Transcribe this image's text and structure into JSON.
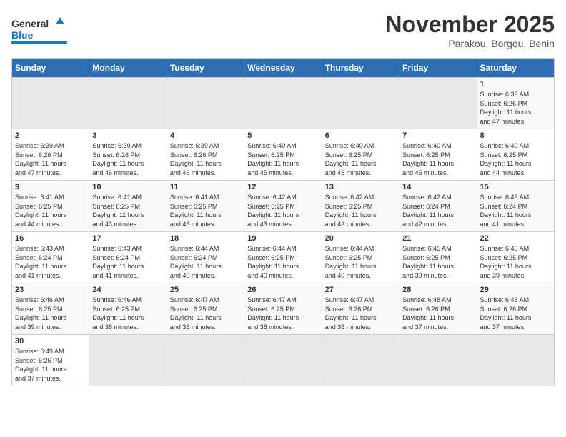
{
  "header": {
    "logo_general": "General",
    "logo_blue": "Blue",
    "title": "November 2025",
    "subtitle": "Parakou, Borgou, Benin"
  },
  "days_of_week": [
    "Sunday",
    "Monday",
    "Tuesday",
    "Wednesday",
    "Thursday",
    "Friday",
    "Saturday"
  ],
  "weeks": [
    [
      {
        "day": "",
        "info": ""
      },
      {
        "day": "",
        "info": ""
      },
      {
        "day": "",
        "info": ""
      },
      {
        "day": "",
        "info": ""
      },
      {
        "day": "",
        "info": ""
      },
      {
        "day": "",
        "info": ""
      },
      {
        "day": "1",
        "info": "Sunrise: 6:39 AM\nSunset: 6:26 PM\nDaylight: 11 hours\nand 47 minutes."
      }
    ],
    [
      {
        "day": "2",
        "info": "Sunrise: 6:39 AM\nSunset: 6:26 PM\nDaylight: 11 hours\nand 47 minutes."
      },
      {
        "day": "3",
        "info": "Sunrise: 6:39 AM\nSunset: 6:26 PM\nDaylight: 11 hours\nand 46 minutes."
      },
      {
        "day": "4",
        "info": "Sunrise: 6:39 AM\nSunset: 6:26 PM\nDaylight: 11 hours\nand 46 minutes."
      },
      {
        "day": "5",
        "info": "Sunrise: 6:40 AM\nSunset: 6:25 PM\nDaylight: 11 hours\nand 45 minutes."
      },
      {
        "day": "6",
        "info": "Sunrise: 6:40 AM\nSunset: 6:25 PM\nDaylight: 11 hours\nand 45 minutes."
      },
      {
        "day": "7",
        "info": "Sunrise: 6:40 AM\nSunset: 6:25 PM\nDaylight: 11 hours\nand 45 minutes."
      },
      {
        "day": "8",
        "info": "Sunrise: 6:40 AM\nSunset: 6:25 PM\nDaylight: 11 hours\nand 44 minutes."
      }
    ],
    [
      {
        "day": "9",
        "info": "Sunrise: 6:41 AM\nSunset: 6:25 PM\nDaylight: 11 hours\nand 44 minutes."
      },
      {
        "day": "10",
        "info": "Sunrise: 6:41 AM\nSunset: 6:25 PM\nDaylight: 11 hours\nand 43 minutes."
      },
      {
        "day": "11",
        "info": "Sunrise: 6:41 AM\nSunset: 6:25 PM\nDaylight: 11 hours\nand 43 minutes."
      },
      {
        "day": "12",
        "info": "Sunrise: 6:42 AM\nSunset: 6:25 PM\nDaylight: 11 hours\nand 43 minutes."
      },
      {
        "day": "13",
        "info": "Sunrise: 6:42 AM\nSunset: 6:25 PM\nDaylight: 11 hours\nand 42 minutes."
      },
      {
        "day": "14",
        "info": "Sunrise: 6:42 AM\nSunset: 6:24 PM\nDaylight: 11 hours\nand 42 minutes."
      },
      {
        "day": "15",
        "info": "Sunrise: 6:43 AM\nSunset: 6:24 PM\nDaylight: 11 hours\nand 41 minutes."
      }
    ],
    [
      {
        "day": "16",
        "info": "Sunrise: 6:43 AM\nSunset: 6:24 PM\nDaylight: 11 hours\nand 41 minutes."
      },
      {
        "day": "17",
        "info": "Sunrise: 6:43 AM\nSunset: 6:24 PM\nDaylight: 11 hours\nand 41 minutes."
      },
      {
        "day": "18",
        "info": "Sunrise: 6:44 AM\nSunset: 6:24 PM\nDaylight: 11 hours\nand 40 minutes."
      },
      {
        "day": "19",
        "info": "Sunrise: 6:44 AM\nSunset: 6:25 PM\nDaylight: 11 hours\nand 40 minutes."
      },
      {
        "day": "20",
        "info": "Sunrise: 6:44 AM\nSunset: 6:25 PM\nDaylight: 11 hours\nand 40 minutes."
      },
      {
        "day": "21",
        "info": "Sunrise: 6:45 AM\nSunset: 6:25 PM\nDaylight: 11 hours\nand 39 minutes."
      },
      {
        "day": "22",
        "info": "Sunrise: 6:45 AM\nSunset: 6:25 PM\nDaylight: 11 hours\nand 39 minutes."
      }
    ],
    [
      {
        "day": "23",
        "info": "Sunrise: 6:46 AM\nSunset: 6:25 PM\nDaylight: 11 hours\nand 39 minutes."
      },
      {
        "day": "24",
        "info": "Sunrise: 6:46 AM\nSunset: 6:25 PM\nDaylight: 11 hours\nand 38 minutes."
      },
      {
        "day": "25",
        "info": "Sunrise: 6:47 AM\nSunset: 6:25 PM\nDaylight: 11 hours\nand 38 minutes."
      },
      {
        "day": "26",
        "info": "Sunrise: 6:47 AM\nSunset: 6:25 PM\nDaylight: 11 hours\nand 38 minutes."
      },
      {
        "day": "27",
        "info": "Sunrise: 6:47 AM\nSunset: 6:26 PM\nDaylight: 11 hours\nand 38 minutes."
      },
      {
        "day": "28",
        "info": "Sunrise: 6:48 AM\nSunset: 6:26 PM\nDaylight: 11 hours\nand 37 minutes."
      },
      {
        "day": "29",
        "info": "Sunrise: 6:48 AM\nSunset: 6:26 PM\nDaylight: 11 hours\nand 37 minutes."
      }
    ],
    [
      {
        "day": "30",
        "info": "Sunrise: 6:49 AM\nSunset: 6:26 PM\nDaylight: 11 hours\nand 37 minutes."
      },
      {
        "day": "",
        "info": ""
      },
      {
        "day": "",
        "info": ""
      },
      {
        "day": "",
        "info": ""
      },
      {
        "day": "",
        "info": ""
      },
      {
        "day": "",
        "info": ""
      },
      {
        "day": "",
        "info": ""
      }
    ]
  ]
}
